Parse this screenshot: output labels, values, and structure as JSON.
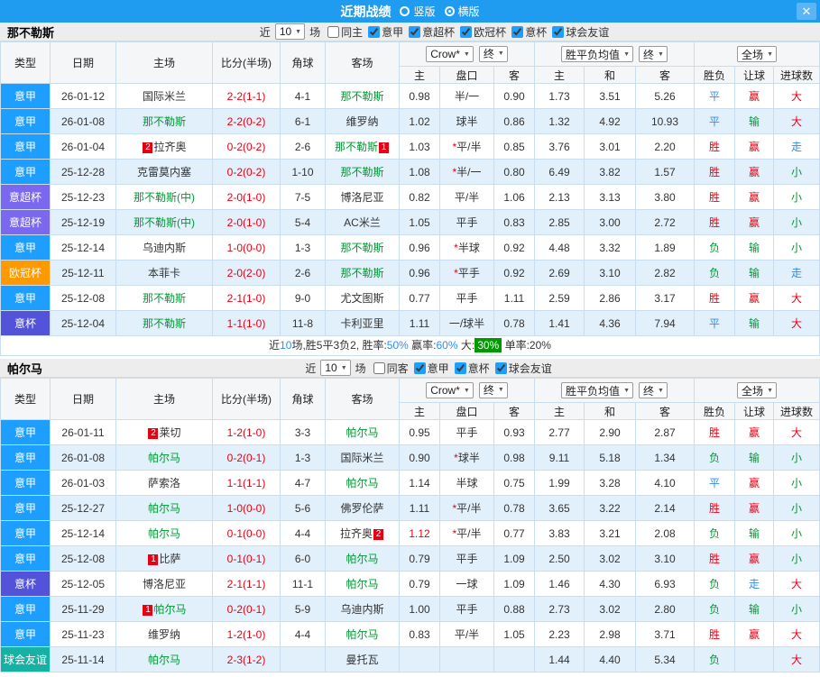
{
  "titlebar": {
    "title": "近期战绩",
    "options": [
      {
        "label": "竖版",
        "selected": false
      },
      {
        "label": "横版",
        "selected": true
      }
    ],
    "close_icon": "✕"
  },
  "league_colors": {
    "意甲": "#1e9fff",
    "意超杯": "#7b68ee",
    "欧冠杯": "#ff9900",
    "意杯": "#5353d9",
    "球会友谊": "#17b1a4"
  },
  "result_colors": {
    "胜": "#e60012",
    "赢": "#e60012",
    "大": "#e60012",
    "平": "#2c8ef0",
    "走": "#2c8ef0",
    "负": "#009933",
    "输": "#009933",
    "小": "#009933"
  },
  "table_header": {
    "type": "类型",
    "date": "日期",
    "home": "主场",
    "score": "比分(半场)",
    "corner": "角球",
    "away": "客场",
    "asia_select": "Crow*",
    "asia_final": "终",
    "europe_select": "胜平负均值",
    "europe_final": "终",
    "scope_select": "全场",
    "sub": [
      "主",
      "盘口",
      "客",
      "主",
      "和",
      "客",
      "胜负",
      "让球",
      "进球数"
    ]
  },
  "sections": [
    {
      "team": "那不勒斯",
      "filter": {
        "near": "近",
        "count": "10",
        "games": "场",
        "same": {
          "label": "同主",
          "checked": false
        },
        "leagues": [
          {
            "label": "意甲",
            "checked": true
          },
          {
            "label": "意超杯",
            "checked": true
          },
          {
            "label": "欧冠杯",
            "checked": true
          },
          {
            "label": "意杯",
            "checked": true
          },
          {
            "label": "球会友谊",
            "checked": true
          }
        ]
      },
      "rows": [
        {
          "league": "意甲",
          "date": "26-01-12",
          "home": {
            "name": "国际米兰",
            "green": false,
            "badge": ""
          },
          "score": "2-2(1-1)",
          "corner": "4-1",
          "away": {
            "name": "那不勒斯",
            "green": true,
            "badge": ""
          },
          "asia": {
            "home": "0.98",
            "home_red": false,
            "star": false,
            "pan": "半/一",
            "away": "0.90"
          },
          "europe": [
            "1.73",
            "3.51",
            "5.26"
          ],
          "results": [
            "平",
            "赢",
            "大"
          ]
        },
        {
          "league": "意甲",
          "date": "26-01-08",
          "home": {
            "name": "那不勒斯",
            "green": true,
            "badge": ""
          },
          "score": "2-2(0-2)",
          "corner": "6-1",
          "away": {
            "name": "维罗纳",
            "green": false,
            "badge": ""
          },
          "asia": {
            "home": "1.02",
            "home_red": false,
            "star": false,
            "pan": "球半",
            "away": "0.86"
          },
          "europe": [
            "1.32",
            "4.92",
            "10.93"
          ],
          "results": [
            "平",
            "输",
            "大"
          ]
        },
        {
          "league": "意甲",
          "date": "26-01-04",
          "home": {
            "name": "拉齐奥",
            "green": false,
            "badge": "2"
          },
          "score": "0-2(0-2)",
          "corner": "2-6",
          "away": {
            "name": "那不勒斯",
            "green": true,
            "badge": "1"
          },
          "asia": {
            "home": "1.03",
            "home_red": false,
            "star": true,
            "pan": "平/半",
            "away": "0.85"
          },
          "europe": [
            "3.76",
            "3.01",
            "2.20"
          ],
          "results": [
            "胜",
            "赢",
            "走"
          ]
        },
        {
          "league": "意甲",
          "date": "25-12-28",
          "home": {
            "name": "克雷莫内塞",
            "green": false,
            "badge": ""
          },
          "score": "0-2(0-2)",
          "corner": "1-10",
          "away": {
            "name": "那不勒斯",
            "green": true,
            "badge": ""
          },
          "asia": {
            "home": "1.08",
            "home_red": false,
            "star": true,
            "pan": "半/一",
            "away": "0.80"
          },
          "europe": [
            "6.49",
            "3.82",
            "1.57"
          ],
          "results": [
            "胜",
            "赢",
            "小"
          ]
        },
        {
          "league": "意超杯",
          "date": "25-12-23",
          "home": {
            "name": "那不勒斯(中)",
            "green": true,
            "badge": ""
          },
          "score": "2-0(1-0)",
          "corner": "7-5",
          "away": {
            "name": "博洛尼亚",
            "green": false,
            "badge": ""
          },
          "asia": {
            "home": "0.82",
            "home_red": false,
            "star": false,
            "pan": "平/半",
            "away": "1.06"
          },
          "europe": [
            "2.13",
            "3.13",
            "3.80"
          ],
          "results": [
            "胜",
            "赢",
            "小"
          ]
        },
        {
          "league": "意超杯",
          "date": "25-12-19",
          "home": {
            "name": "那不勒斯(中)",
            "green": true,
            "badge": ""
          },
          "score": "2-0(1-0)",
          "corner": "5-4",
          "away": {
            "name": "AC米兰",
            "green": false,
            "badge": ""
          },
          "asia": {
            "home": "1.05",
            "home_red": false,
            "star": false,
            "pan": "平手",
            "away": "0.83"
          },
          "europe": [
            "2.85",
            "3.00",
            "2.72"
          ],
          "results": [
            "胜",
            "赢",
            "小"
          ]
        },
        {
          "league": "意甲",
          "date": "25-12-14",
          "home": {
            "name": "乌迪内斯",
            "green": false,
            "badge": ""
          },
          "score": "1-0(0-0)",
          "corner": "1-3",
          "away": {
            "name": "那不勒斯",
            "green": true,
            "badge": ""
          },
          "asia": {
            "home": "0.96",
            "home_red": false,
            "star": true,
            "pan": "半球",
            "away": "0.92"
          },
          "europe": [
            "4.48",
            "3.32",
            "1.89"
          ],
          "results": [
            "负",
            "输",
            "小"
          ]
        },
        {
          "league": "欧冠杯",
          "date": "25-12-11",
          "home": {
            "name": "本菲卡",
            "green": false,
            "badge": ""
          },
          "score": "2-0(2-0)",
          "corner": "2-6",
          "away": {
            "name": "那不勒斯",
            "green": true,
            "badge": ""
          },
          "asia": {
            "home": "0.96",
            "home_red": false,
            "star": true,
            "pan": "平手",
            "away": "0.92"
          },
          "europe": [
            "2.69",
            "3.10",
            "2.82"
          ],
          "results": [
            "负",
            "输",
            "走"
          ]
        },
        {
          "league": "意甲",
          "date": "25-12-08",
          "home": {
            "name": "那不勒斯",
            "green": true,
            "badge": ""
          },
          "score": "2-1(1-0)",
          "corner": "9-0",
          "away": {
            "name": "尤文图斯",
            "green": false,
            "badge": ""
          },
          "asia": {
            "home": "0.77",
            "home_red": false,
            "star": false,
            "pan": "平手",
            "away": "1.11"
          },
          "europe": [
            "2.59",
            "2.86",
            "3.17"
          ],
          "results": [
            "胜",
            "赢",
            "大"
          ]
        },
        {
          "league": "意杯",
          "date": "25-12-04",
          "home": {
            "name": "那不勒斯",
            "green": true,
            "badge": ""
          },
          "score": "1-1(1-0)",
          "corner": "11-8",
          "away": {
            "name": "卡利亚里",
            "green": false,
            "badge": ""
          },
          "asia": {
            "home": "1.11",
            "home_red": false,
            "star": false,
            "pan": "一/球半",
            "away": "0.78"
          },
          "europe": [
            "1.41",
            "4.36",
            "7.94"
          ],
          "results": [
            "平",
            "输",
            "大"
          ]
        }
      ],
      "summary": [
        {
          "text": "近",
          "style": "plain"
        },
        {
          "text": "10",
          "style": "blue"
        },
        {
          "text": "场,胜5平3负2, 胜率:",
          "style": "plain"
        },
        {
          "text": "50%",
          "style": "blue"
        },
        {
          "text": " 赢率:",
          "style": "plain"
        },
        {
          "text": "60%",
          "style": "blue"
        },
        {
          "text": " 大:",
          "style": "plain"
        },
        {
          "text": "30%",
          "style": "greenbg"
        },
        {
          "text": " 单率:20%",
          "style": "plain"
        }
      ]
    },
    {
      "team": "帕尔马",
      "filter": {
        "near": "近",
        "count": "10",
        "games": "场",
        "same": {
          "label": "同客",
          "checked": false
        },
        "leagues": [
          {
            "label": "意甲",
            "checked": true
          },
          {
            "label": "意杯",
            "checked": true
          },
          {
            "label": "球会友谊",
            "checked": true
          }
        ]
      },
      "rows": [
        {
          "league": "意甲",
          "date": "26-01-11",
          "home": {
            "name": "莱切",
            "green": false,
            "badge": "2"
          },
          "score": "1-2(1-0)",
          "corner": "3-3",
          "away": {
            "name": "帕尔马",
            "green": true,
            "badge": ""
          },
          "asia": {
            "home": "0.95",
            "home_red": false,
            "star": false,
            "pan": "平手",
            "away": "0.93"
          },
          "europe": [
            "2.77",
            "2.90",
            "2.87"
          ],
          "results": [
            "胜",
            "赢",
            "大"
          ]
        },
        {
          "league": "意甲",
          "date": "26-01-08",
          "home": {
            "name": "帕尔马",
            "green": true,
            "badge": ""
          },
          "score": "0-2(0-1)",
          "corner": "1-3",
          "away": {
            "name": "国际米兰",
            "green": false,
            "badge": ""
          },
          "asia": {
            "home": "0.90",
            "home_red": false,
            "star": true,
            "pan": "球半",
            "away": "0.98"
          },
          "europe": [
            "9.11",
            "5.18",
            "1.34"
          ],
          "results": [
            "负",
            "输",
            "小"
          ]
        },
        {
          "league": "意甲",
          "date": "26-01-03",
          "home": {
            "name": "萨索洛",
            "green": false,
            "badge": ""
          },
          "score": "1-1(1-1)",
          "corner": "4-7",
          "away": {
            "name": "帕尔马",
            "green": true,
            "badge": ""
          },
          "asia": {
            "home": "1.14",
            "home_red": false,
            "star": false,
            "pan": "半球",
            "away": "0.75"
          },
          "europe": [
            "1.99",
            "3.28",
            "4.10"
          ],
          "results": [
            "平",
            "赢",
            "小"
          ]
        },
        {
          "league": "意甲",
          "date": "25-12-27",
          "home": {
            "name": "帕尔马",
            "green": true,
            "badge": ""
          },
          "score": "1-0(0-0)",
          "corner": "5-6",
          "away": {
            "name": "佛罗伦萨",
            "green": false,
            "badge": ""
          },
          "asia": {
            "home": "1.11",
            "home_red": false,
            "star": true,
            "pan": "平/半",
            "away": "0.78"
          },
          "europe": [
            "3.65",
            "3.22",
            "2.14"
          ],
          "results": [
            "胜",
            "赢",
            "小"
          ]
        },
        {
          "league": "意甲",
          "date": "25-12-14",
          "home": {
            "name": "帕尔马",
            "green": true,
            "badge": ""
          },
          "score": "0-1(0-0)",
          "corner": "4-4",
          "away": {
            "name": "拉齐奥",
            "green": false,
            "badge": "2"
          },
          "asia": {
            "home": "1.12",
            "home_red": true,
            "star": true,
            "pan": "平/半",
            "away": "0.77"
          },
          "europe": [
            "3.83",
            "3.21",
            "2.08"
          ],
          "results": [
            "负",
            "输",
            "小"
          ]
        },
        {
          "league": "意甲",
          "date": "25-12-08",
          "home": {
            "name": "比萨",
            "green": false,
            "badge": "1"
          },
          "score": "0-1(0-1)",
          "corner": "6-0",
          "away": {
            "name": "帕尔马",
            "green": true,
            "badge": ""
          },
          "asia": {
            "home": "0.79",
            "home_red": false,
            "star": false,
            "pan": "平手",
            "away": "1.09"
          },
          "europe": [
            "2.50",
            "3.02",
            "3.10"
          ],
          "results": [
            "胜",
            "赢",
            "小"
          ]
        },
        {
          "league": "意杯",
          "date": "25-12-05",
          "home": {
            "name": "博洛尼亚",
            "green": false,
            "badge": ""
          },
          "score": "2-1(1-1)",
          "corner": "11-1",
          "away": {
            "name": "帕尔马",
            "green": true,
            "badge": ""
          },
          "asia": {
            "home": "0.79",
            "home_red": false,
            "star": false,
            "pan": "一球",
            "away": "1.09"
          },
          "europe": [
            "1.46",
            "4.30",
            "6.93"
          ],
          "results": [
            "负",
            "走",
            "大"
          ]
        },
        {
          "league": "意甲",
          "date": "25-11-29",
          "home": {
            "name": "帕尔马",
            "green": true,
            "badge": "1"
          },
          "score": "0-2(0-1)",
          "corner": "5-9",
          "away": {
            "name": "乌迪内斯",
            "green": false,
            "badge": ""
          },
          "asia": {
            "home": "1.00",
            "home_red": false,
            "star": false,
            "pan": "平手",
            "away": "0.88"
          },
          "europe": [
            "2.73",
            "3.02",
            "2.80"
          ],
          "results": [
            "负",
            "输",
            "小"
          ]
        },
        {
          "league": "意甲",
          "date": "25-11-23",
          "home": {
            "name": "维罗纳",
            "green": false,
            "badge": ""
          },
          "score": "1-2(1-0)",
          "corner": "4-4",
          "away": {
            "name": "帕尔马",
            "green": true,
            "badge": ""
          },
          "asia": {
            "home": "0.83",
            "home_red": false,
            "star": false,
            "pan": "平/半",
            "away": "1.05"
          },
          "europe": [
            "2.23",
            "2.98",
            "3.71"
          ],
          "results": [
            "胜",
            "赢",
            "大"
          ]
        },
        {
          "league": "球会友谊",
          "date": "25-11-14",
          "home": {
            "name": "帕尔马",
            "green": true,
            "badge": ""
          },
          "score": "2-3(1-2)",
          "corner": "",
          "away": {
            "name": "曼托瓦",
            "green": false,
            "badge": ""
          },
          "asia": {
            "home": "",
            "home_red": false,
            "star": false,
            "pan": "",
            "away": ""
          },
          "europe": [
            "1.44",
            "4.40",
            "5.34"
          ],
          "results": [
            "负",
            "",
            "大"
          ]
        }
      ],
      "summary": null
    }
  ]
}
